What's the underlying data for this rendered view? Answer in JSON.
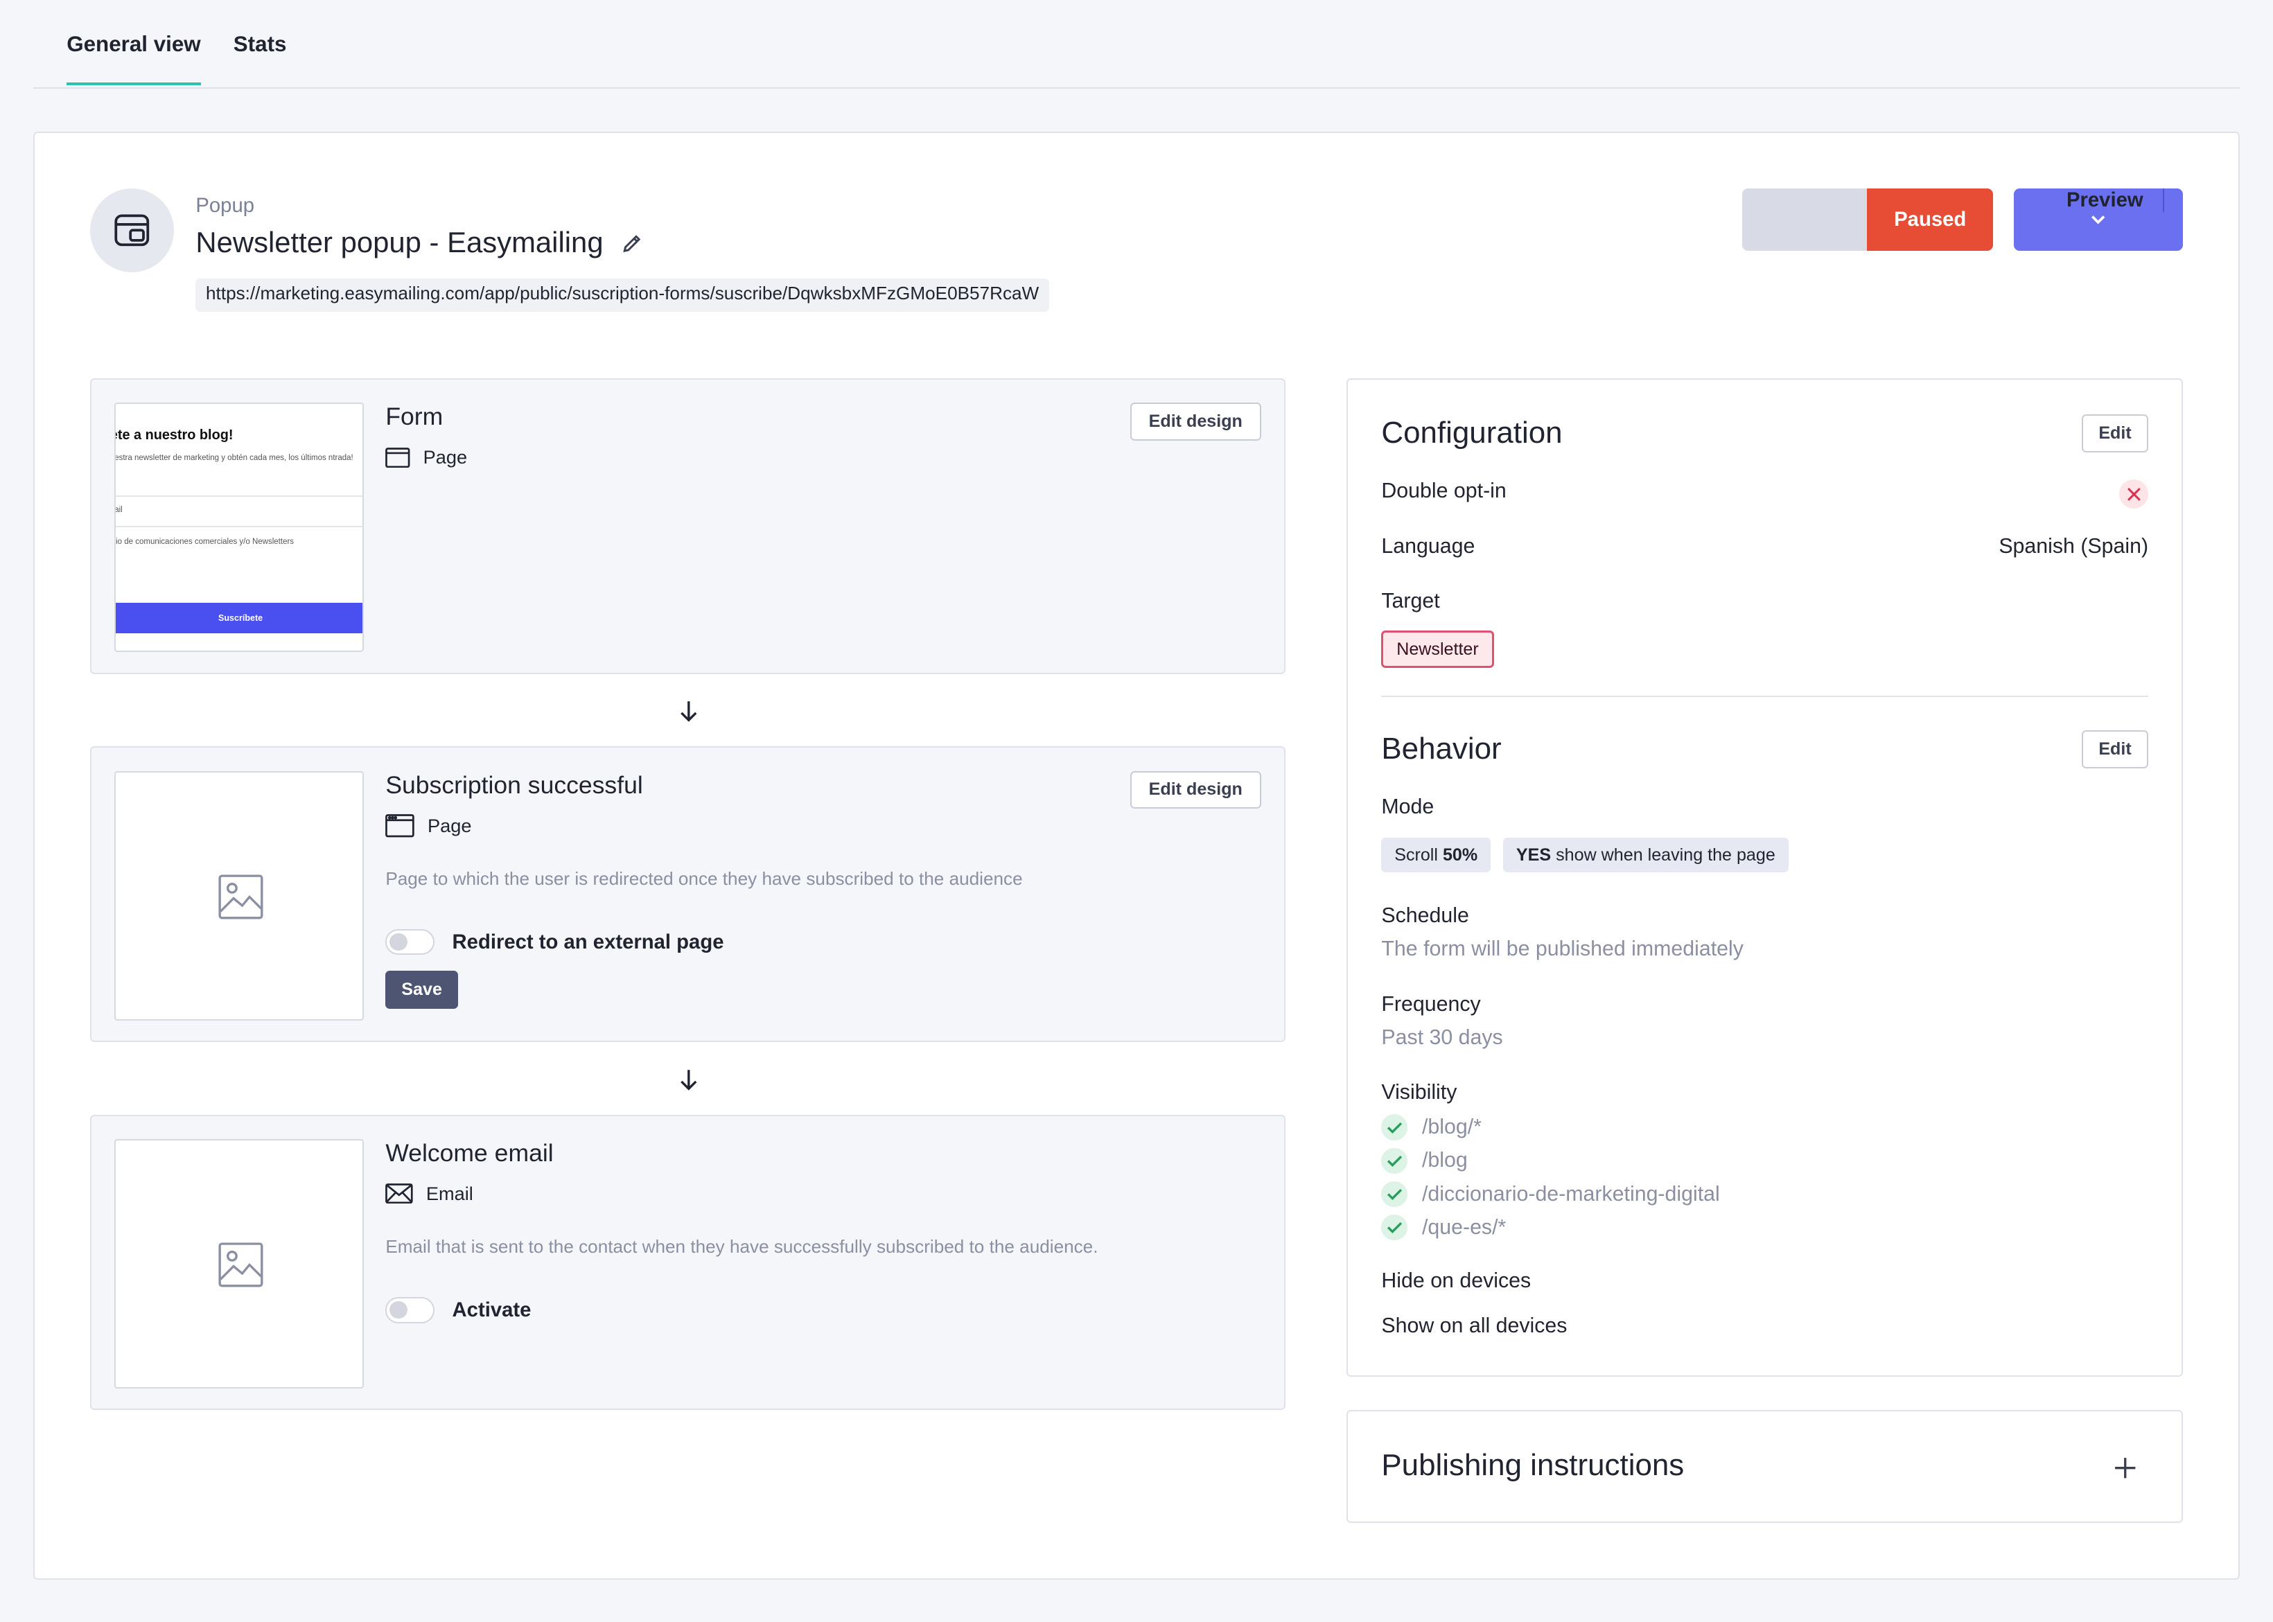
{
  "tabs": [
    {
      "label": "General view",
      "active": true
    },
    {
      "label": "Stats",
      "active": false
    }
  ],
  "header": {
    "kicker": "Popup",
    "title": "Newsletter popup - Easymailing",
    "url": "https://marketing.easymailing.com/app/public/suscription-forms/suscribe/DqwksbxMFzGMoE0B57RcaW",
    "status_label": "Paused",
    "preview_label": "Preview"
  },
  "steps": {
    "form": {
      "title": "Form",
      "type": "Page",
      "edit_label": "Edit design",
      "thumb_title": "ete a nuestro blog!",
      "thumb_text": "uestra newsletter de marketing y obtén cada mes, los últimos ntrada!",
      "thumb_field": "nail",
      "thumb_consent": "ivio de comunicaciones comerciales y/o Newsletters",
      "thumb_button": "Suscríbete"
    },
    "success": {
      "title": "Subscription successful",
      "type": "Page",
      "edit_label": "Edit design",
      "description": "Page to which the user is redirected once they have subscribed to the audience",
      "toggle_label": "Redirect to an external page",
      "save_label": "Save"
    },
    "welcome": {
      "title": "Welcome email",
      "type": "Email",
      "description": "Email that is sent to the contact when they have successfully subscribed to the audience.",
      "toggle_label": "Activate"
    }
  },
  "configuration": {
    "title": "Configuration",
    "edit_label": "Edit",
    "double_optin_label": "Double opt-in",
    "double_optin_enabled": false,
    "language_label": "Language",
    "language_value": "Spanish (Spain)",
    "target_label": "Target",
    "target_value": "Newsletter"
  },
  "behavior": {
    "title": "Behavior",
    "edit_label": "Edit",
    "mode_label": "Mode",
    "mode_chip1_prefix": "Scroll",
    "mode_chip1_value": "50%",
    "mode_chip2_prefix": "YES",
    "mode_chip2_text": "show when leaving the page",
    "schedule_label": "Schedule",
    "schedule_value": "The form will be published immediately",
    "frequency_label": "Frequency",
    "frequency_value": "Past 30 days",
    "visibility_label": "Visibility",
    "visibility": [
      "/blog/*",
      "/blog",
      "/diccionario-de-marketing-digital",
      "/que-es/*"
    ],
    "hide_label": "Hide on devices",
    "hide_value": "Show on all devices"
  },
  "publishing": {
    "title": "Publishing instructions"
  },
  "colors": {
    "accent_tab": "#2cc4b0",
    "paused": "#e74c35",
    "preview": "#6a70f0",
    "save": "#4d5572"
  }
}
